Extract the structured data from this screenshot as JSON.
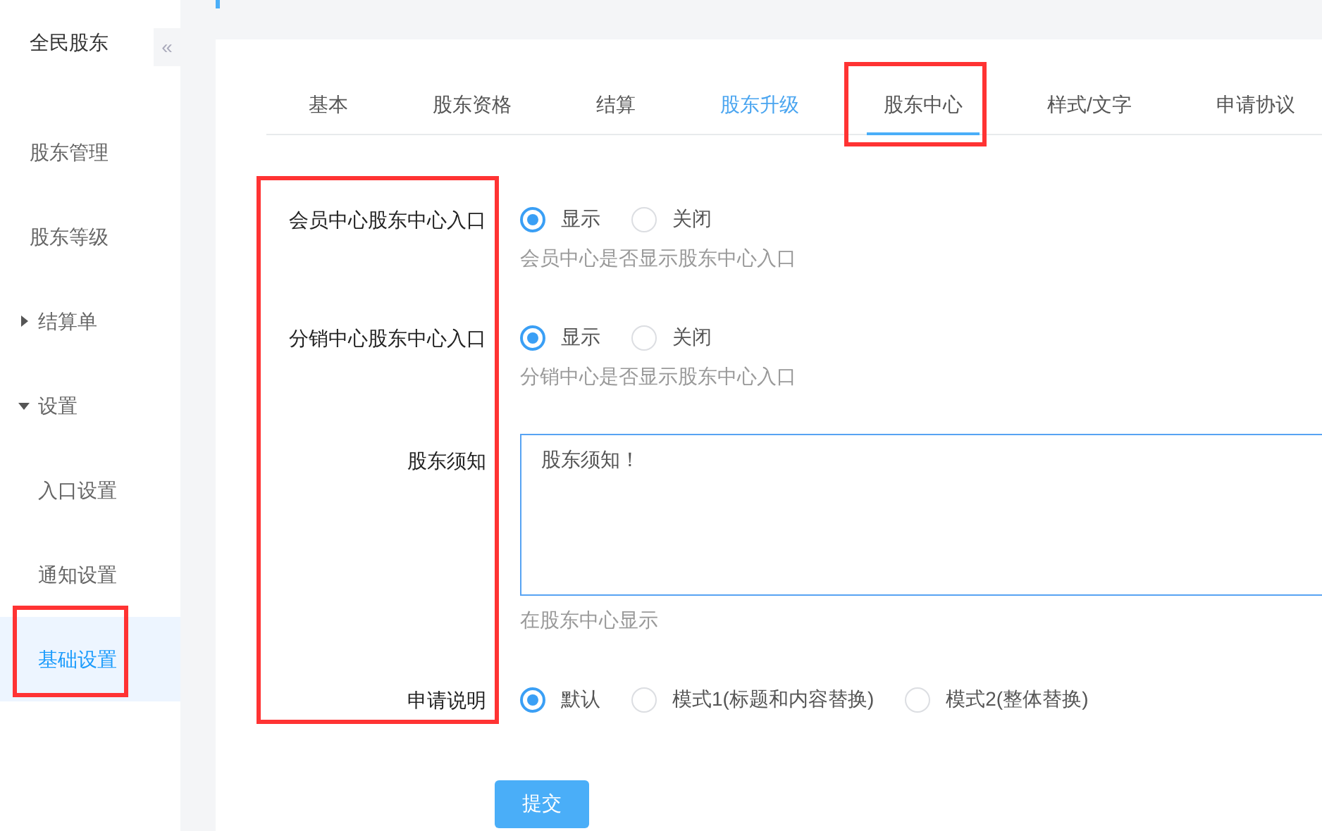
{
  "sidebar": {
    "title": "全民股东",
    "collapse_icon": "«",
    "items": [
      {
        "label": "股东管理",
        "kind": "link",
        "selected": false,
        "highlighted": false
      },
      {
        "label": "股东等级",
        "kind": "link",
        "selected": false,
        "highlighted": false
      },
      {
        "label": "结算单",
        "kind": "group",
        "expanded": false,
        "selected": false,
        "highlighted": false
      },
      {
        "label": "设置",
        "kind": "group",
        "expanded": true,
        "selected": false,
        "highlighted": false,
        "children": [
          {
            "label": "入口设置",
            "kind": "link",
            "selected": false,
            "highlighted": false
          },
          {
            "label": "通知设置",
            "kind": "link",
            "selected": false,
            "highlighted": false
          },
          {
            "label": "基础设置",
            "kind": "link",
            "selected": true,
            "highlighted": true
          }
        ]
      }
    ]
  },
  "tabs": [
    {
      "label": "基本",
      "selected": false,
      "hovered": false,
      "highlighted": false
    },
    {
      "label": "股东资格",
      "selected": false,
      "hovered": false,
      "highlighted": false
    },
    {
      "label": "结算",
      "selected": false,
      "hovered": false,
      "highlighted": false
    },
    {
      "label": "股东升级",
      "selected": false,
      "hovered": true,
      "highlighted": false
    },
    {
      "label": "股东中心",
      "selected": true,
      "hovered": false,
      "highlighted": true
    },
    {
      "label": "样式/文字",
      "selected": false,
      "hovered": false,
      "highlighted": false
    },
    {
      "label": "申请协议",
      "selected": false,
      "hovered": false,
      "highlighted": false
    }
  ],
  "form": {
    "labels_highlighted": true,
    "rows": [
      {
        "kind": "radio",
        "label": "会员中心股东中心入口",
        "options": [
          {
            "label": "显示",
            "selected": true
          },
          {
            "label": "关闭",
            "selected": false
          }
        ],
        "hint": "会员中心是否显示股东中心入口"
      },
      {
        "kind": "radio",
        "label": "分销中心股东中心入口",
        "options": [
          {
            "label": "显示",
            "selected": true
          },
          {
            "label": "关闭",
            "selected": false
          }
        ],
        "hint": "分销中心是否显示股东中心入口"
      },
      {
        "kind": "textarea",
        "label": "股东须知",
        "value": "股东须知！",
        "hint": "在股东中心显示"
      },
      {
        "kind": "radio",
        "label": "申请说明",
        "options": [
          {
            "label": "默认",
            "selected": true
          },
          {
            "label": "模式1(标题和内容替换)",
            "selected": false
          },
          {
            "label": "模式2(整体替换)",
            "selected": false
          }
        ]
      }
    ],
    "submit": "提交"
  }
}
